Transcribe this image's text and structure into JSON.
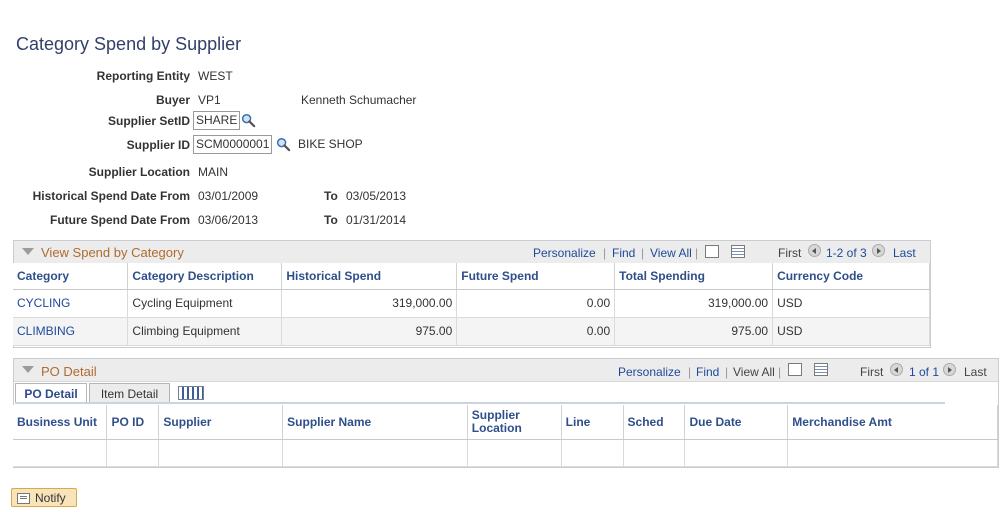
{
  "page": {
    "title": "Category Spend by Supplier"
  },
  "criteria": {
    "reporting_entity": {
      "label": "Reporting Entity",
      "value": "WEST"
    },
    "buyer": {
      "label": "Buyer",
      "value": "VP1",
      "name": "Kenneth Schumacher"
    },
    "supplier_setid": {
      "label": "Supplier SetID",
      "value": "SHARE"
    },
    "supplier_id": {
      "label": "Supplier ID",
      "value": "SCM0000001",
      "name": "BIKE SHOP"
    },
    "supplier_location": {
      "label": "Supplier Location",
      "value": "MAIN"
    },
    "historical": {
      "label": "Historical Spend Date From",
      "from": "03/01/2009",
      "to_label": "To",
      "to": "03/05/2013"
    },
    "future": {
      "label": "Future Spend Date From",
      "from": "03/06/2013",
      "to_label": "To",
      "to": "01/31/2014"
    }
  },
  "spend_grid": {
    "title": "View Spend by Category",
    "personalize": "Personalize",
    "find": "Find",
    "view_all": "View All",
    "first": "First",
    "range": "1-2 of 3",
    "last": "Last",
    "columns": [
      "Category",
      "Category Description",
      "Historical Spend",
      "Future Spend",
      "Total Spending",
      "Currency Code"
    ],
    "rows": [
      [
        "CYCLING",
        "Cycling Equipment",
        "319,000.00",
        "0.00",
        "319,000.00",
        "USD"
      ],
      [
        "CLIMBING",
        "Climbing Equipment",
        "975.00",
        "0.00",
        "975.00",
        "USD"
      ]
    ]
  },
  "po_grid": {
    "title": "PO Detail",
    "personalize": "Personalize",
    "find": "Find",
    "view_all": "View All",
    "first": "First",
    "range": "1 of 1",
    "last": "Last",
    "tabs": [
      "PO Detail",
      "Item Detail"
    ],
    "columns": [
      "Business Unit",
      "PO ID",
      "Supplier",
      "Supplier Name",
      "Supplier Location",
      "Line",
      "Sched",
      "Due Date",
      "Merchandise Amt"
    ]
  },
  "notify_button": {
    "label": "Notify"
  }
}
